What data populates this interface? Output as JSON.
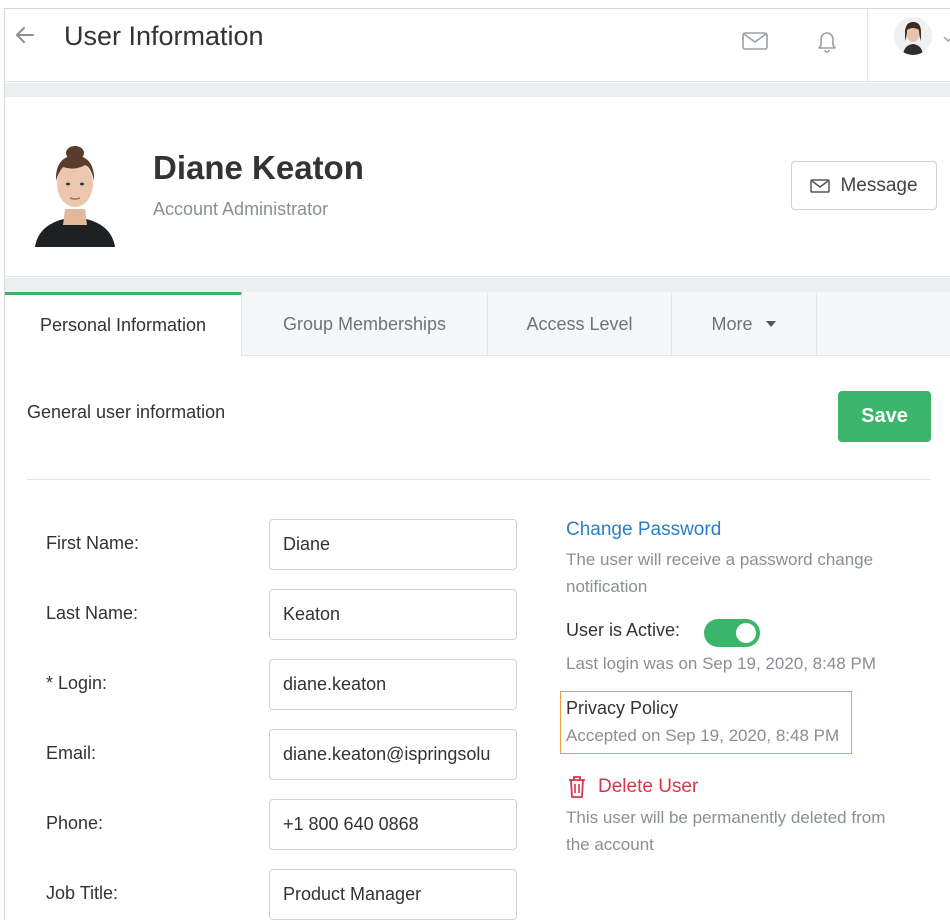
{
  "header": {
    "title": "User Information"
  },
  "profile": {
    "name": "Diane Keaton",
    "role": "Account Administrator",
    "message_label": "Message"
  },
  "tabs": [
    {
      "label": "Personal Information",
      "active": true
    },
    {
      "label": "Group Memberships",
      "active": false
    },
    {
      "label": "Access Level",
      "active": false
    },
    {
      "label": "More",
      "active": false
    }
  ],
  "form": {
    "section_title": "General user information",
    "save_label": "Save",
    "fields": [
      {
        "label": "First Name:",
        "value": "Diane"
      },
      {
        "label": "Last Name:",
        "value": "Keaton"
      },
      {
        "label": "* Login:",
        "value": "diane.keaton"
      },
      {
        "label": "Email:",
        "value": "diane.keaton@ispringsolu"
      },
      {
        "label": "Phone:",
        "value": "+1 800 640 0868"
      },
      {
        "label": "Job Title:",
        "value": "Product Manager"
      }
    ]
  },
  "sidebar": {
    "change_password_label": "Change Password",
    "change_password_note": "The user will receive a password change notification",
    "active_label": "User is Active:",
    "active": true,
    "last_login": "Last login was on Sep 19, 2020, 8:48 PM",
    "privacy_title": "Privacy Policy",
    "privacy_note": "Accepted on Sep 19, 2020, 8:48 PM",
    "delete_label": "Delete User",
    "delete_note": "This user will be permanently deleted from the account"
  },
  "colors": {
    "accent_green": "#3bb56a",
    "link_blue": "#2a7fc4",
    "danger_red": "#d9364a",
    "highlight_orange": "#f29c4a"
  },
  "icons": {
    "back": "arrow-left-icon",
    "mail": "mail-icon",
    "bell": "bell-icon",
    "trash": "trash-icon"
  }
}
